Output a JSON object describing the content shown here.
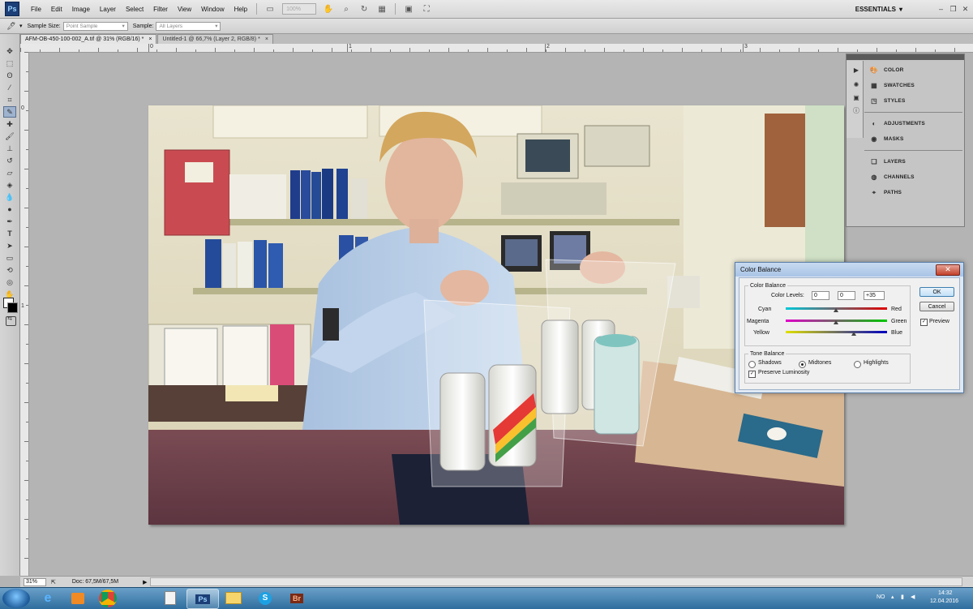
{
  "app": {
    "logo": "Ps"
  },
  "menubar": {
    "items": [
      "File",
      "Edit",
      "Image",
      "Layer",
      "Select",
      "Filter",
      "View",
      "Window",
      "Help"
    ],
    "zoom": "100%",
    "workspace": "ESSENTIALS"
  },
  "options_bar": {
    "sample_size_label": "Sample Size:",
    "sample_size_value": "Point Sample",
    "sample_label": "Sample:",
    "sample_value": "All Layers"
  },
  "tabs": [
    {
      "label": "AFM-OB-450-100-002_A.tif @ 31% (RGB/16) *"
    },
    {
      "label": "Untitled-1 @ 66,7% (Layer 2, RGB/8) *"
    }
  ],
  "ruler": {
    "h_labels": [
      "0",
      "1",
      "2",
      "3"
    ],
    "v_labels": [
      "0",
      "1"
    ]
  },
  "status": {
    "zoom": "31%",
    "doc": "Doc: 67,5M/67,5M"
  },
  "panels": {
    "group1": [
      "COLOR",
      "SWATCHES",
      "STYLES"
    ],
    "group2": [
      "ADJUSTMENTS",
      "MASKS"
    ],
    "group3": [
      "LAYERS",
      "CHANNELS",
      "PATHS"
    ]
  },
  "dialog": {
    "title": "Color Balance",
    "color_balance_legend": "Color Balance",
    "color_levels_label": "Color Levels:",
    "levels": [
      "0",
      "0",
      "+35"
    ],
    "sliders": [
      {
        "left": "Cyan",
        "right": "Red",
        "value": 0
      },
      {
        "left": "Magenta",
        "right": "Green",
        "value": 0
      },
      {
        "left": "Yellow",
        "right": "Blue",
        "value": 35
      }
    ],
    "tone_legend": "Tone Balance",
    "tones": [
      "Shadows",
      "Midtones",
      "Highlights"
    ],
    "selected_tone": "Midtones",
    "preserve_label": "Preserve Luminosity",
    "preserve_checked": true,
    "ok_label": "OK",
    "cancel_label": "Cancel",
    "preview_label": "Preview",
    "preview_checked": true,
    "colors": {
      "title_bar": "#a9c4e6",
      "close": "#c2412b"
    }
  },
  "taskbar": {
    "apps": [
      "ie-icon",
      "media-player-icon",
      "chrome-icon",
      "document-icon",
      "photoshop-icon",
      "folder-icon",
      "skype-icon",
      "bridge-icon"
    ],
    "ps_label": "Ps",
    "br_label": "Br",
    "lang": "NO",
    "time": "14:32",
    "date": "12.04.2016"
  }
}
